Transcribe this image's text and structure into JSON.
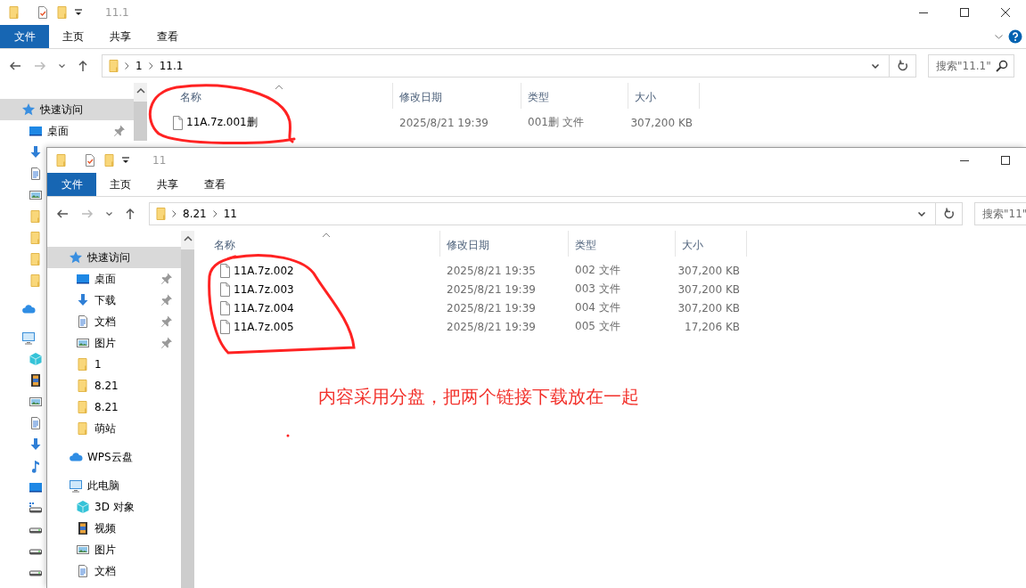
{
  "windows": [
    {
      "title": "11.1",
      "window_controls": [
        {
          "kind": "minimize"
        },
        {
          "kind": "maximize"
        },
        {
          "kind": "close"
        }
      ],
      "ribbon_toggle": true,
      "ribbon_tabs": [
        {
          "label": "文件",
          "selected": true
        },
        {
          "label": "主页",
          "selected": false
        },
        {
          "label": "共享",
          "selected": false
        },
        {
          "label": "查看",
          "selected": false
        }
      ],
      "path": [
        "1",
        "11.1"
      ],
      "search": {
        "placeholder": "搜索\"11.1\"",
        "icon": true
      },
      "sidebar": [
        {
          "kind": "quick-access",
          "label": "快速访问",
          "selected": true,
          "children": [
            {
              "kind": "desktop",
              "label": "桌面",
              "pinned": true,
              "selected": false
            },
            {
              "kind": "download",
              "pinned": false,
              "selected": false
            },
            {
              "kind": "documents",
              "pinned": false,
              "selected": false
            },
            {
              "kind": "pictures",
              "pinned": false,
              "selected": false
            },
            {
              "kind": "folder",
              "pinned": false,
              "selected": false
            },
            {
              "kind": "folder",
              "pinned": false,
              "selected": false
            },
            {
              "kind": "folder",
              "pinned": false,
              "selected": false
            },
            {
              "kind": "folder",
              "pinned": false,
              "selected": false
            }
          ]
        },
        {
          "kind": "cloud",
          "selected": false
        },
        {
          "kind": "pc",
          "selected": false,
          "children": [
            {
              "kind": "objects",
              "pinned": false,
              "selected": false
            },
            {
              "kind": "videos",
              "pinned": false,
              "selected": false
            },
            {
              "kind": "pictures",
              "pinned": false,
              "selected": false
            },
            {
              "kind": "documents",
              "pinned": false,
              "selected": false
            },
            {
              "kind": "download",
              "pinned": false,
              "selected": false
            },
            {
              "kind": "music",
              "pinned": false,
              "selected": false
            },
            {
              "kind": "desktop",
              "pinned": false,
              "selected": false
            },
            {
              "kind": "network-drive",
              "pinned": false,
              "selected": false
            },
            {
              "kind": "drive",
              "pinned": false,
              "selected": false
            },
            {
              "kind": "drive",
              "pinned": false,
              "selected": false
            },
            {
              "kind": "drive",
              "pinned": false,
              "selected": false
            }
          ]
        }
      ],
      "columns": [
        "名称",
        "修改日期",
        "类型",
        "大小"
      ],
      "files": [
        {
          "name": "11A.7z.001删",
          "modified": "2025/8/21 19:39",
          "type": "001删 文件",
          "size": "307,200 KB"
        }
      ]
    },
    {
      "title": "11",
      "window_controls": [
        {
          "kind": "minimize"
        },
        {
          "kind": "maximize"
        }
      ],
      "ribbon_tabs": [
        {
          "label": "文件",
          "selected": true
        },
        {
          "label": "主页",
          "selected": false
        },
        {
          "label": "共享",
          "selected": false
        },
        {
          "label": "查看",
          "selected": false
        }
      ],
      "path": [
        "8.21",
        "11"
      ],
      "search": {
        "placeholder": "搜索\"11\"",
        "icon": false
      },
      "sidebar": [
        {
          "kind": "quick-access",
          "label": "快速访问",
          "selected": true,
          "children": [
            {
              "kind": "desktop",
              "label": "桌面",
              "pinned": true,
              "selected": false
            },
            {
              "kind": "download",
              "label": "下载",
              "pinned": true,
              "selected": false
            },
            {
              "kind": "documents",
              "label": "文档",
              "pinned": true,
              "selected": false
            },
            {
              "kind": "pictures",
              "label": "图片",
              "pinned": true,
              "selected": false
            },
            {
              "kind": "folder",
              "label": "1",
              "pinned": false,
              "selected": false
            },
            {
              "kind": "folder",
              "label": "8.21",
              "pinned": false,
              "selected": false
            },
            {
              "kind": "folder",
              "label": "8.21",
              "pinned": false,
              "selected": false
            },
            {
              "kind": "folder",
              "label": "萌站",
              "pinned": false,
              "selected": false
            }
          ]
        },
        {
          "kind": "cloud",
          "label": "WPS云盘",
          "selected": false
        },
        {
          "kind": "pc",
          "label": "此电脑",
          "selected": false,
          "children": [
            {
              "kind": "objects",
              "label": "3D 对象",
              "pinned": false,
              "selected": false
            },
            {
              "kind": "videos",
              "label": "视频",
              "pinned": false,
              "selected": false
            },
            {
              "kind": "pictures",
              "label": "图片",
              "pinned": false,
              "selected": false
            },
            {
              "kind": "documents",
              "label": "文档",
              "pinned": false,
              "selected": false
            }
          ]
        }
      ],
      "columns": [
        "名称",
        "修改日期",
        "类型",
        "大小"
      ],
      "files": [
        {
          "name": "11A.7z.002",
          "modified": "2025/8/21 19:35",
          "type": "002 文件",
          "size": "307,200 KB"
        },
        {
          "name": "11A.7z.003",
          "modified": "2025/8/21 19:39",
          "type": "003 文件",
          "size": "307,200 KB"
        },
        {
          "name": "11A.7z.004",
          "modified": "2025/8/21 19:39",
          "type": "004 文件",
          "size": "307,200 KB"
        },
        {
          "name": "11A.7z.005",
          "modified": "2025/8/21 19:39",
          "type": "005 文件",
          "size": "17,206 KB"
        }
      ]
    }
  ],
  "note": "内容采用分盘，把两个链接下载放在一起"
}
